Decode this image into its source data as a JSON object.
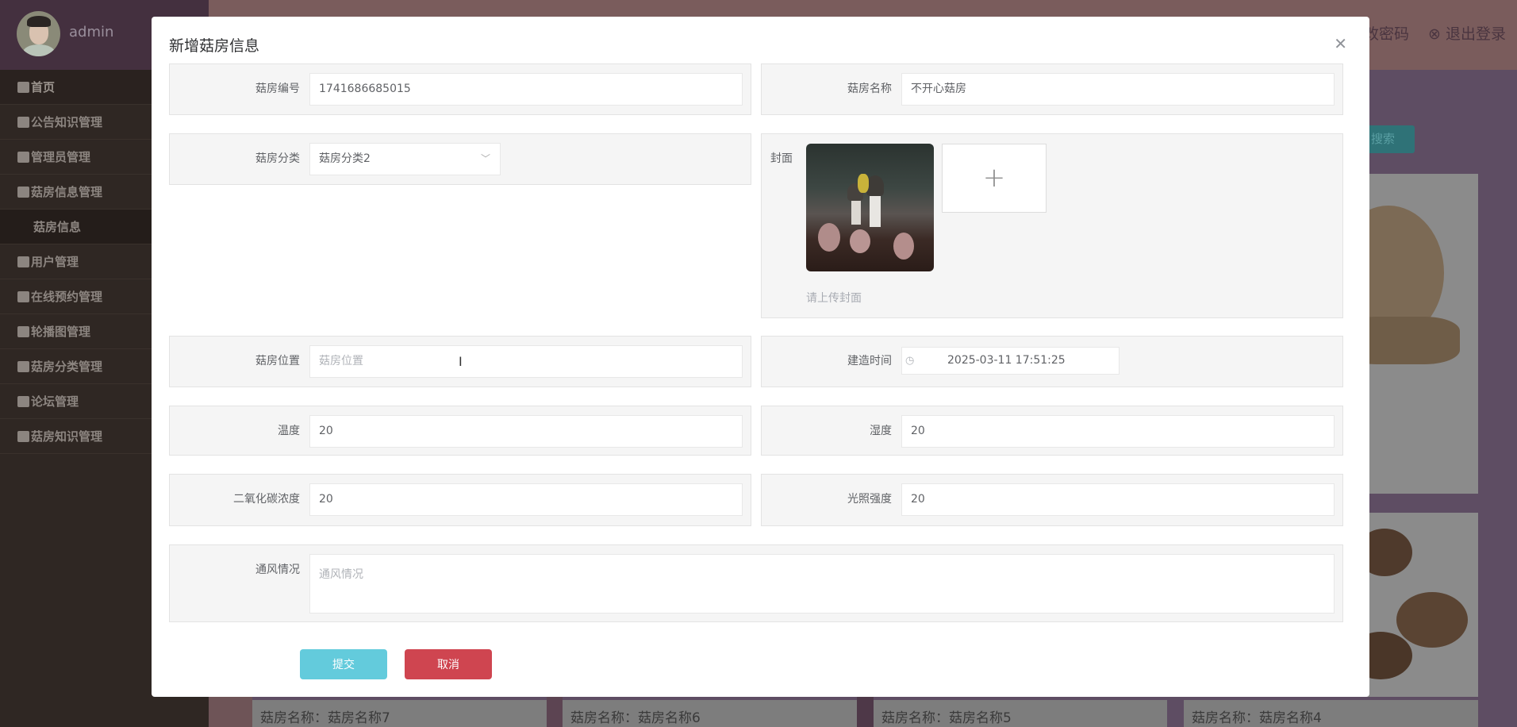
{
  "sidebar": {
    "username": "admin",
    "items": [
      {
        "label": "首页",
        "icon": "home-icon"
      },
      {
        "label": "公告知识管理",
        "icon": "briefcase-icon"
      },
      {
        "label": "管理员管理",
        "icon": "user-icon"
      },
      {
        "label": "菇房信息管理",
        "icon": "briefcase-icon"
      },
      {
        "label": "菇房信息",
        "icon": ""
      },
      {
        "label": "用户管理",
        "icon": "user-icon"
      },
      {
        "label": "在线预约管理",
        "icon": "folder-icon"
      },
      {
        "label": "轮播图管理",
        "icon": "image-icon"
      },
      {
        "label": "菇房分类管理",
        "icon": "list-icon"
      },
      {
        "label": "论坛管理",
        "icon": "bank-icon"
      },
      {
        "label": "菇房知识管理",
        "icon": "grid-icon"
      }
    ]
  },
  "header": {
    "change_password": "改密码",
    "logout": "退出登录"
  },
  "background": {
    "search_label": "搜索",
    "cards": [
      "菇房名称：菇房名称7",
      "菇房名称：菇房名称6",
      "菇房名称：菇房名称5",
      "菇房名称：菇房名称4"
    ]
  },
  "modal": {
    "title": "新增菇房信息",
    "fields": {
      "code": {
        "label": "菇房编号",
        "value": "1741686685015"
      },
      "name": {
        "label": "菇房名称",
        "value": "不开心菇房"
      },
      "category": {
        "label": "菇房分类",
        "value": "菇房分类2"
      },
      "cover": {
        "label": "封面",
        "hint": "请上传封面"
      },
      "location": {
        "label": "菇房位置",
        "placeholder": "菇房位置"
      },
      "build_time": {
        "label": "建造时间",
        "value": "2025-03-11 17:51:25"
      },
      "temperature": {
        "label": "温度",
        "value": "20"
      },
      "humidity": {
        "label": "湿度",
        "value": "20"
      },
      "co2": {
        "label": "二氧化碳浓度",
        "value": "20"
      },
      "light": {
        "label": "光照强度",
        "value": "20"
      },
      "ventilation": {
        "label": "通风情况",
        "placeholder": "通风情况"
      }
    },
    "submit": "提交",
    "cancel": "取消"
  },
  "colors": {
    "submit": "#63cbdc",
    "cancel": "#cf4550",
    "sidebar": "#2f2723"
  }
}
